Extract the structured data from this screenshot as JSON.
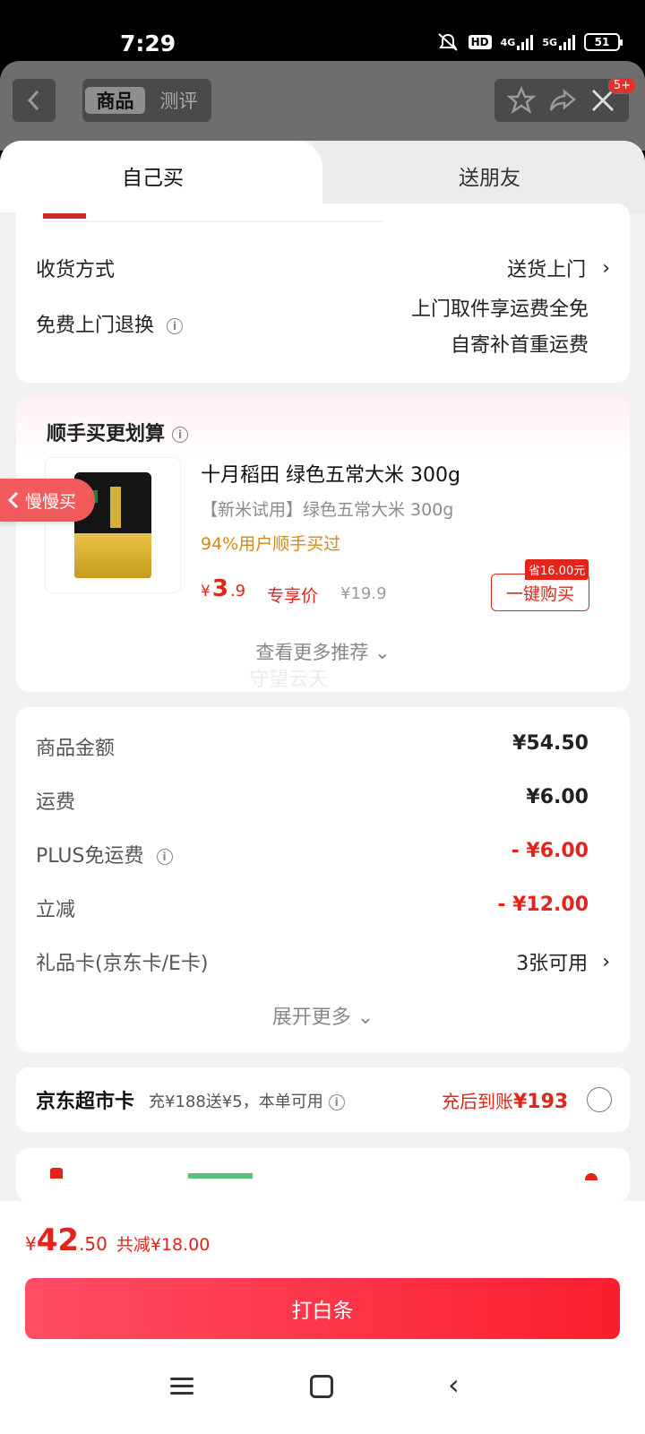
{
  "status_bar": {
    "time": "7:29",
    "net1": "4G",
    "net2": "5G",
    "hd": "HD",
    "battery": "51"
  },
  "header": {
    "tab_goods": "商品",
    "tab_review": "测评",
    "badge": "5+"
  },
  "tabs": {
    "self": "自己买",
    "gift": "送朋友"
  },
  "delivery": {
    "method_label": "收货方式",
    "method_value": "送货上门",
    "return_label": "免费上门退换",
    "return_line1": "上门取件享运费全免",
    "return_line2": "自寄补首重运费"
  },
  "recommend": {
    "title": "顺手买更划算",
    "product_name": "十月稻田 绿色五常大米 300g",
    "product_sub": "【新米试用】绿色五常大米 300g",
    "product_tip": "94%用户顺手买过",
    "price_symbol": "¥",
    "price_int": "3",
    "price_dec": ".9",
    "price_tag": "专享价",
    "old_price": "¥19.9",
    "save_badge": "省16.00元",
    "buy_label": "一键购买",
    "more_label": "查看更多推荐",
    "watermark": "守望云天"
  },
  "price_detail": {
    "rows": [
      {
        "label": "商品金额",
        "value": "¥54.50"
      },
      {
        "label": "运费",
        "value": "¥6.00"
      },
      {
        "label": "PLUS免运费",
        "value": "- ¥6.00"
      },
      {
        "label": "立减",
        "value": "- ¥12.00"
      },
      {
        "label": "礼品卡(京东卡/E卡)",
        "value": "3张可用"
      }
    ],
    "expand_label": "展开更多"
  },
  "jd_card": {
    "title": "京东超市卡",
    "desc": "充¥188送¥5，本单可用",
    "right_prefix": "充后到账",
    "right_amount": "¥193"
  },
  "floating_tab": "慢慢买",
  "bottom": {
    "total_symbol": "¥",
    "total_int": "42",
    "total_dec": ".50",
    "saved": "共减¥18.00",
    "pay_label": "打白条"
  },
  "colors": {
    "accent": "#e1251b",
    "pay_gradient_start": "#ff4d64",
    "pay_gradient_end": "#fa1e2e"
  }
}
